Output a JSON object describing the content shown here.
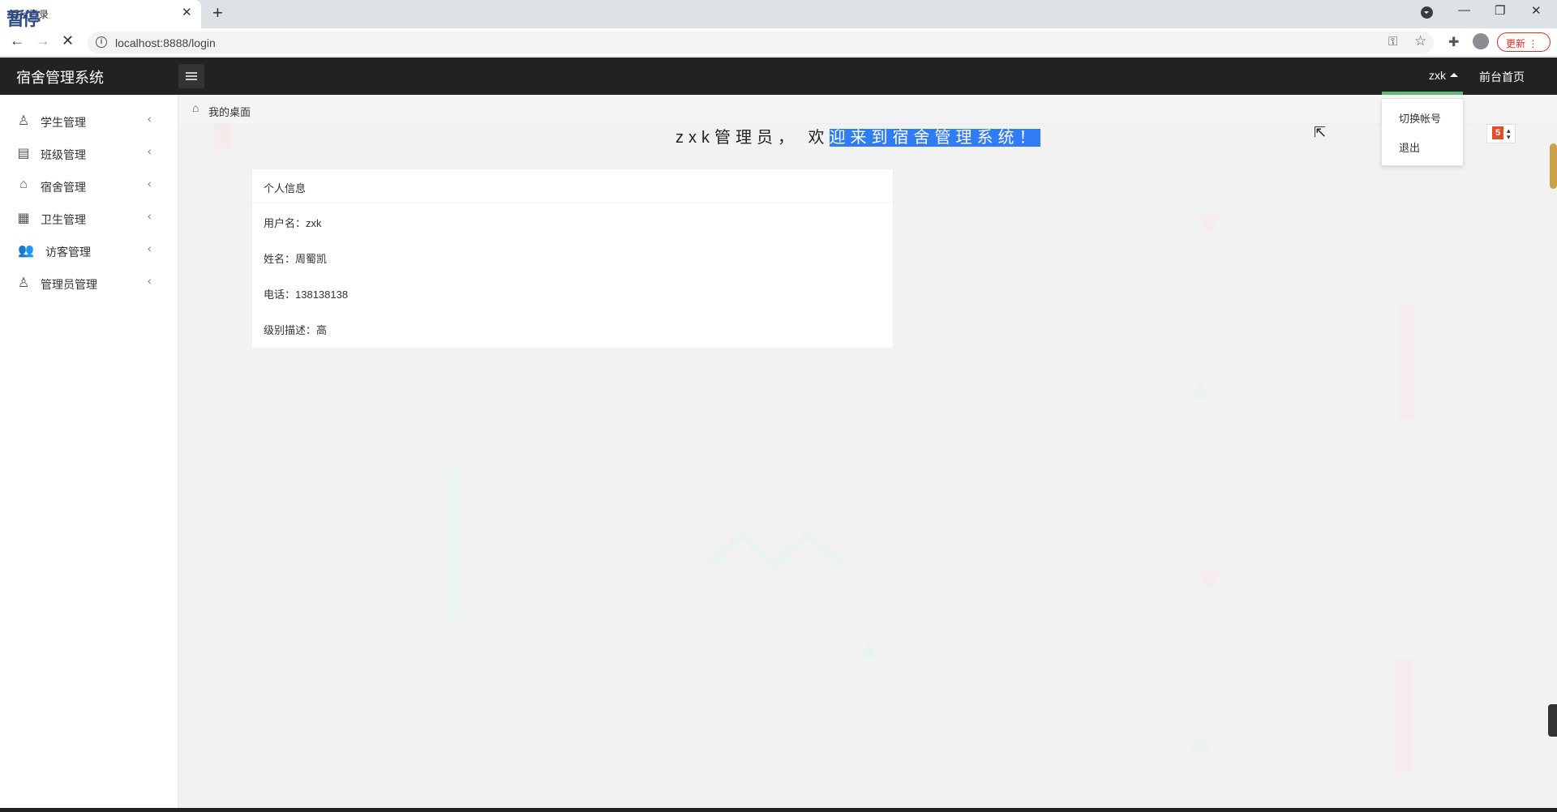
{
  "browser": {
    "tab_title": "后台登录",
    "tab_overlay": "暂停",
    "url": "localhost:8888/login",
    "update_label": "更新"
  },
  "header": {
    "app_title": "宿舍管理系统",
    "username": "zxk",
    "frontend_link": "前台首页",
    "user_menu_items": [
      "切换帐号",
      "退出"
    ]
  },
  "sidebar": {
    "items": [
      {
        "label": "学生管理",
        "icon": "user-icon"
      },
      {
        "label": "班级管理",
        "icon": "class-icon"
      },
      {
        "label": "宿舍管理",
        "icon": "dorm-icon"
      },
      {
        "label": "卫生管理",
        "icon": "hygiene-icon"
      },
      {
        "label": "访客管理",
        "icon": "visitors-icon"
      },
      {
        "label": "管理员管理",
        "icon": "admin-icon"
      }
    ]
  },
  "main": {
    "breadcrumb": "我的桌面",
    "welcome_prefix": "zxk管理员， 欢",
    "welcome_selected": "迎来到宿舍管理系统！",
    "card": {
      "title": "个人信息",
      "fields": [
        "用户名：zxk",
        "姓名：周蜀凯",
        "电话：138138138",
        "级别描述：高"
      ]
    }
  },
  "colors": {
    "header_bg": "#222222",
    "accent_underline": "#5fb878",
    "selection": "#2f7cf6"
  }
}
